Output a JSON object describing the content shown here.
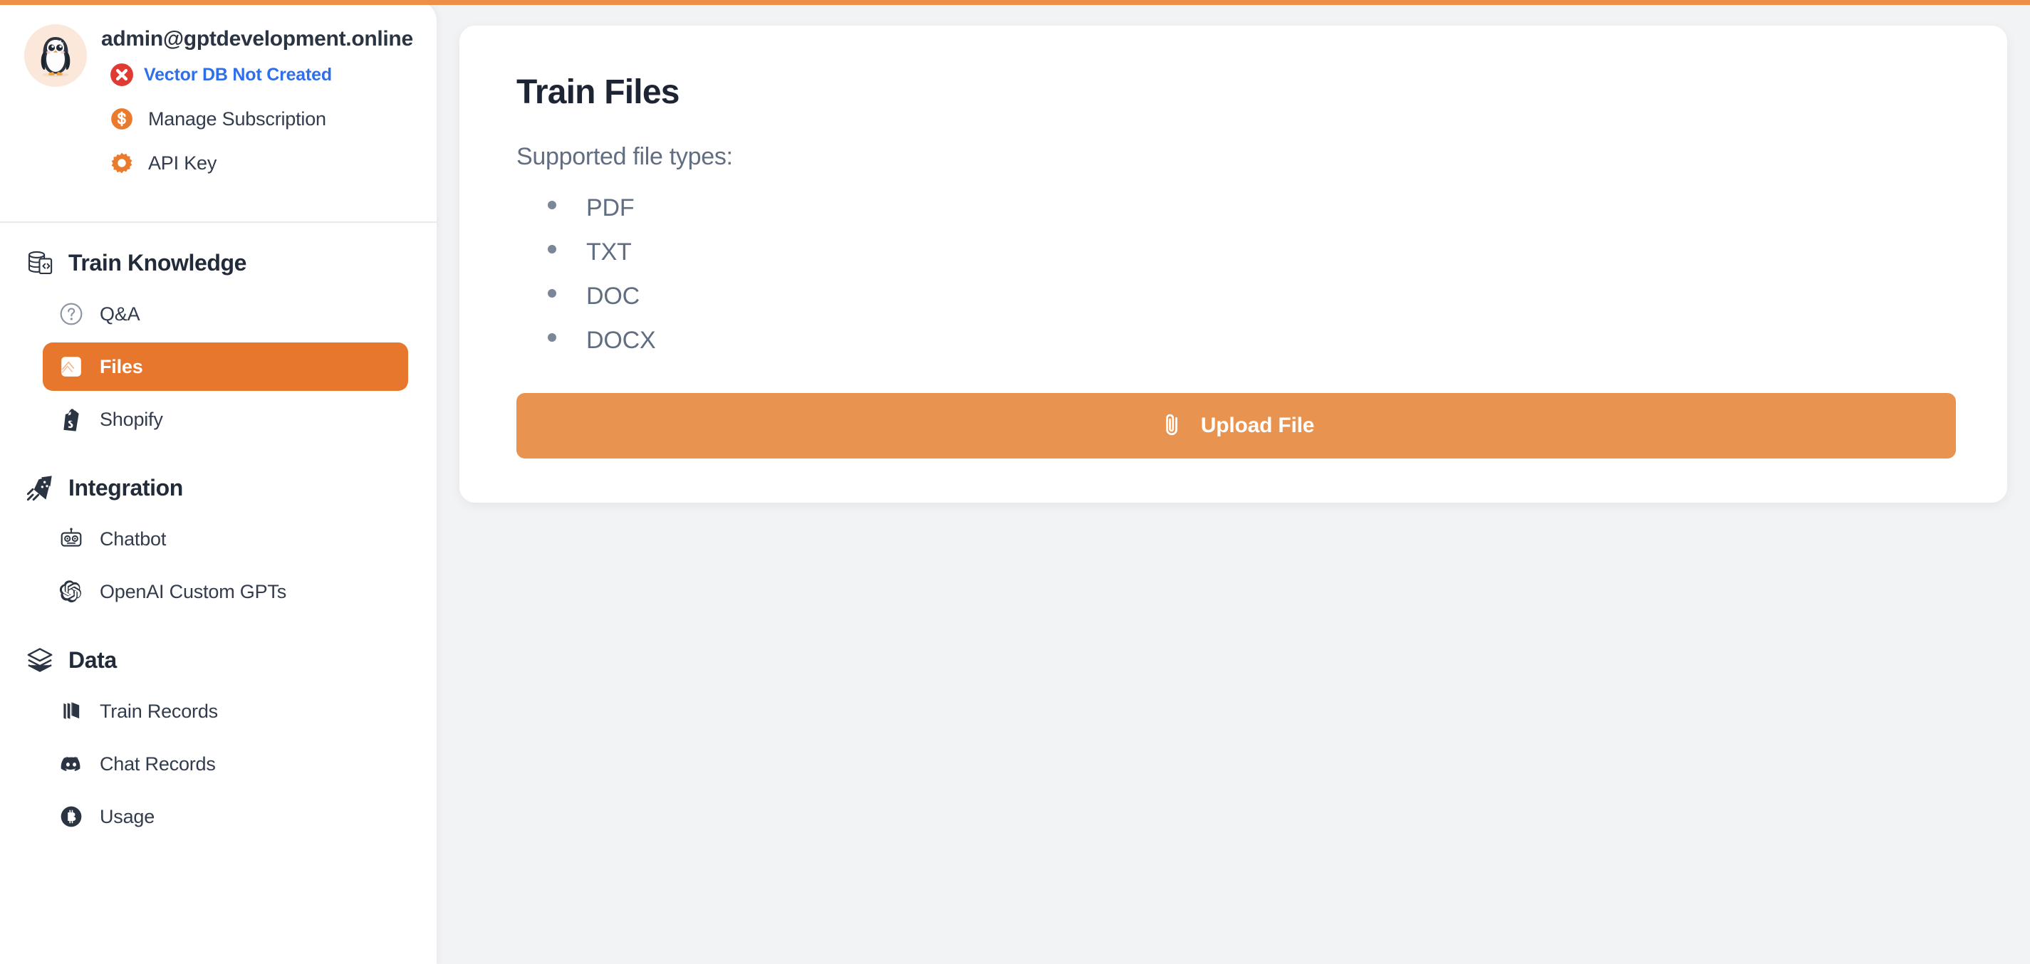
{
  "theme": {
    "accent_orange": "#ed8f46",
    "active_pill_orange": "#e8772e",
    "upload_button_orange": "#e8934f",
    "link_blue": "#2f6fea",
    "error_red": "#e03a32",
    "page_background": "#f2f3f5",
    "sidebar_background": "#ffffff",
    "heading_color": "#1d2534",
    "muted_text": "#616d81"
  },
  "sidebar": {
    "account": {
      "avatar_icon": "penguin-avatar",
      "email": "admin@gptdevelopment.online",
      "status": {
        "icon": "error-circle-x-icon",
        "label": "Vector DB Not Created"
      },
      "links": [
        {
          "icon": "dollar-circle-icon",
          "label": "Manage Subscription"
        },
        {
          "icon": "gear-icon",
          "label": "API Key"
        }
      ]
    },
    "groups": [
      {
        "id": "train-knowledge",
        "icon": "database-code-icon",
        "title": "Train Knowledge",
        "items": [
          {
            "id": "qa",
            "icon": "question-circle-icon",
            "label": "Q&A",
            "active": false
          },
          {
            "id": "files",
            "icon": "file-page-icon",
            "label": "Files",
            "active": true
          },
          {
            "id": "shopify",
            "icon": "shopify-bag-icon",
            "label": "Shopify",
            "active": false
          }
        ]
      },
      {
        "id": "integration",
        "icon": "kite-icon",
        "title": "Integration",
        "items": [
          {
            "id": "chatbot",
            "icon": "robot-icon",
            "label": "Chatbot",
            "active": false
          },
          {
            "id": "openai-custom-gpts",
            "icon": "openai-logo-icon",
            "label": "OpenAI Custom GPTs",
            "active": false
          }
        ]
      },
      {
        "id": "data",
        "icon": "layers-icon",
        "title": "Data",
        "items": [
          {
            "id": "train-records",
            "icon": "books-icon",
            "label": "Train Records",
            "active": false
          },
          {
            "id": "chat-records",
            "icon": "discord-icon",
            "label": "Chat Records",
            "active": false
          },
          {
            "id": "usage",
            "icon": "bitcoin-icon",
            "label": "Usage",
            "active": false
          }
        ]
      }
    ]
  },
  "main": {
    "card": {
      "title": "Train Files",
      "supported_heading": "Supported file types:",
      "file_types": [
        "PDF",
        "TXT",
        "DOC",
        "DOCX"
      ],
      "upload_button": {
        "icon": "paperclip-icon",
        "label": "Upload File"
      }
    }
  }
}
